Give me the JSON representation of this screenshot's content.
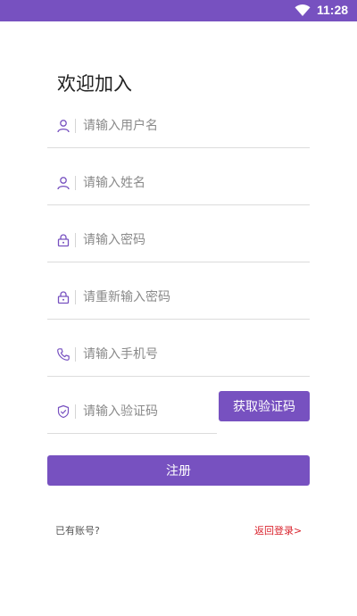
{
  "status_bar": {
    "time": "11:28",
    "wifi_icon": "wifi-icon",
    "background": "#7751c0"
  },
  "page": {
    "welcome_title": "欢迎加入"
  },
  "fields": {
    "username": {
      "icon": "user-icon",
      "placeholder": "请输入用户名",
      "value": ""
    },
    "name": {
      "icon": "user-icon",
      "placeholder": "请输入姓名",
      "value": ""
    },
    "password": {
      "icon": "lock-icon",
      "placeholder": "请输入密码",
      "value": ""
    },
    "confirm_password": {
      "icon": "lock-icon",
      "placeholder": "请重新输入密码",
      "value": ""
    },
    "phone": {
      "icon": "phone-icon",
      "placeholder": "请输入手机号",
      "value": ""
    },
    "verify_code": {
      "icon": "shield-check-icon",
      "placeholder": "请输入验证码",
      "value": ""
    }
  },
  "buttons": {
    "get_code_label": "获取验证码",
    "register_label": "注册"
  },
  "footer": {
    "has_account_text": "已有账号?",
    "back_login_text": "返回登录>"
  },
  "colors": {
    "accent": "#7751c0",
    "link_red": "#d9232d"
  }
}
